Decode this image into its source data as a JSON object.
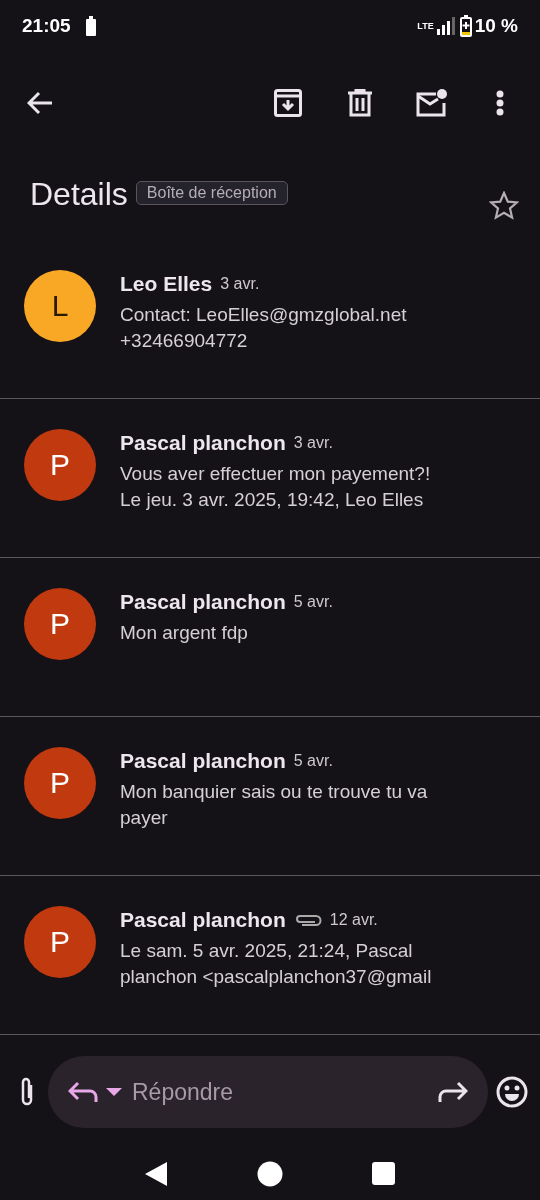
{
  "status_bar": {
    "time": "21:05",
    "network": "LTE",
    "battery": "10 %"
  },
  "header": {
    "title": "Details",
    "label": "Boîte de réception",
    "starred": false
  },
  "messages": [
    {
      "initial": "L",
      "color": "#f9a825",
      "sender": "Leo Elles",
      "date": "3 avr.",
      "attachment": false,
      "lines": [
        "Contact: LeoElles@gmzglobal.net",
        "+32466904772"
      ]
    },
    {
      "initial": "P",
      "color": "#c1390f",
      "sender": "Pascal planchon",
      "date": "3 avr.",
      "attachment": false,
      "lines": [
        "Vous aver effectuer mon payement?!",
        "Le jeu. 3 avr. 2025, 19:42, Leo Elles"
      ]
    },
    {
      "initial": "P",
      "color": "#c1390f",
      "sender": "Pascal planchon",
      "date": "5 avr.",
      "attachment": false,
      "lines": [
        "Mon argent fdp"
      ]
    },
    {
      "initial": "P",
      "color": "#c1390f",
      "sender": "Pascal planchon",
      "date": "5 avr.",
      "attachment": false,
      "lines": [
        "Mon banquier sais ou te trouve tu va",
        "payer"
      ]
    },
    {
      "initial": "P",
      "color": "#c1390f",
      "sender": "Pascal planchon",
      "date": "12 avr.",
      "attachment": true,
      "lines": [
        "Le sam. 5 avr. 2025, 21:24, Pascal",
        "planchon <pascalplanchon37@gmail"
      ]
    }
  ],
  "reply_bar": {
    "placeholder": "Répondre"
  }
}
